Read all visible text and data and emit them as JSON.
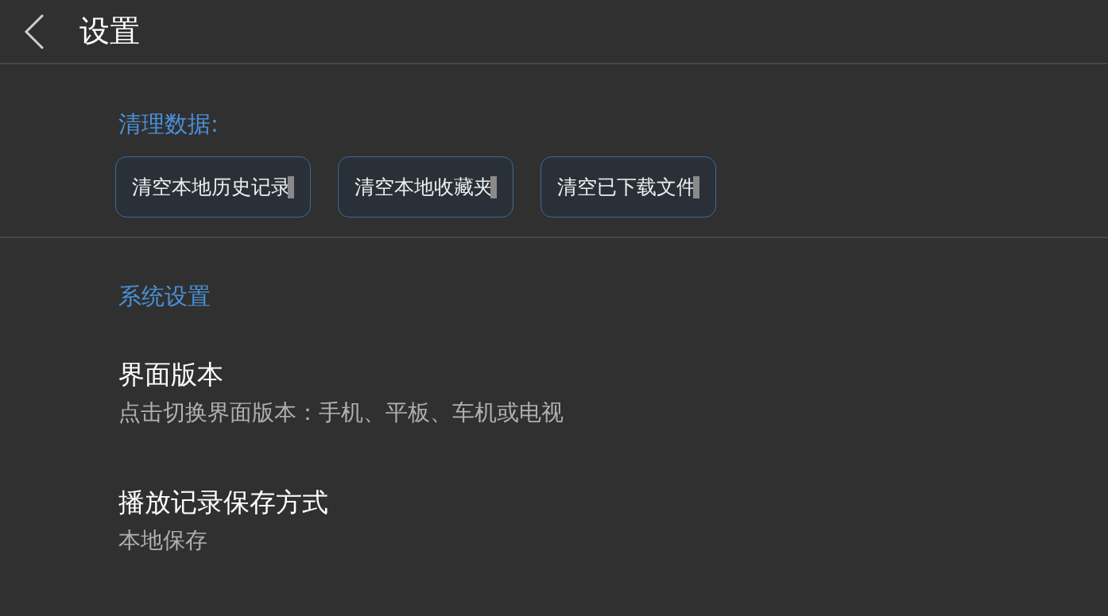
{
  "header": {
    "title": "设置"
  },
  "clear_data": {
    "heading": "清理数据:",
    "buttons": [
      "清空本地历史记录",
      "清空本地收藏夹",
      "清空已下载文件"
    ]
  },
  "system": {
    "heading": "系统设置",
    "items": [
      {
        "title": "界面版本",
        "subtitle": "点击切换界面版本：手机、平板、车机或电视"
      },
      {
        "title": "播放记录保存方式",
        "subtitle": "本地保存"
      }
    ]
  }
}
